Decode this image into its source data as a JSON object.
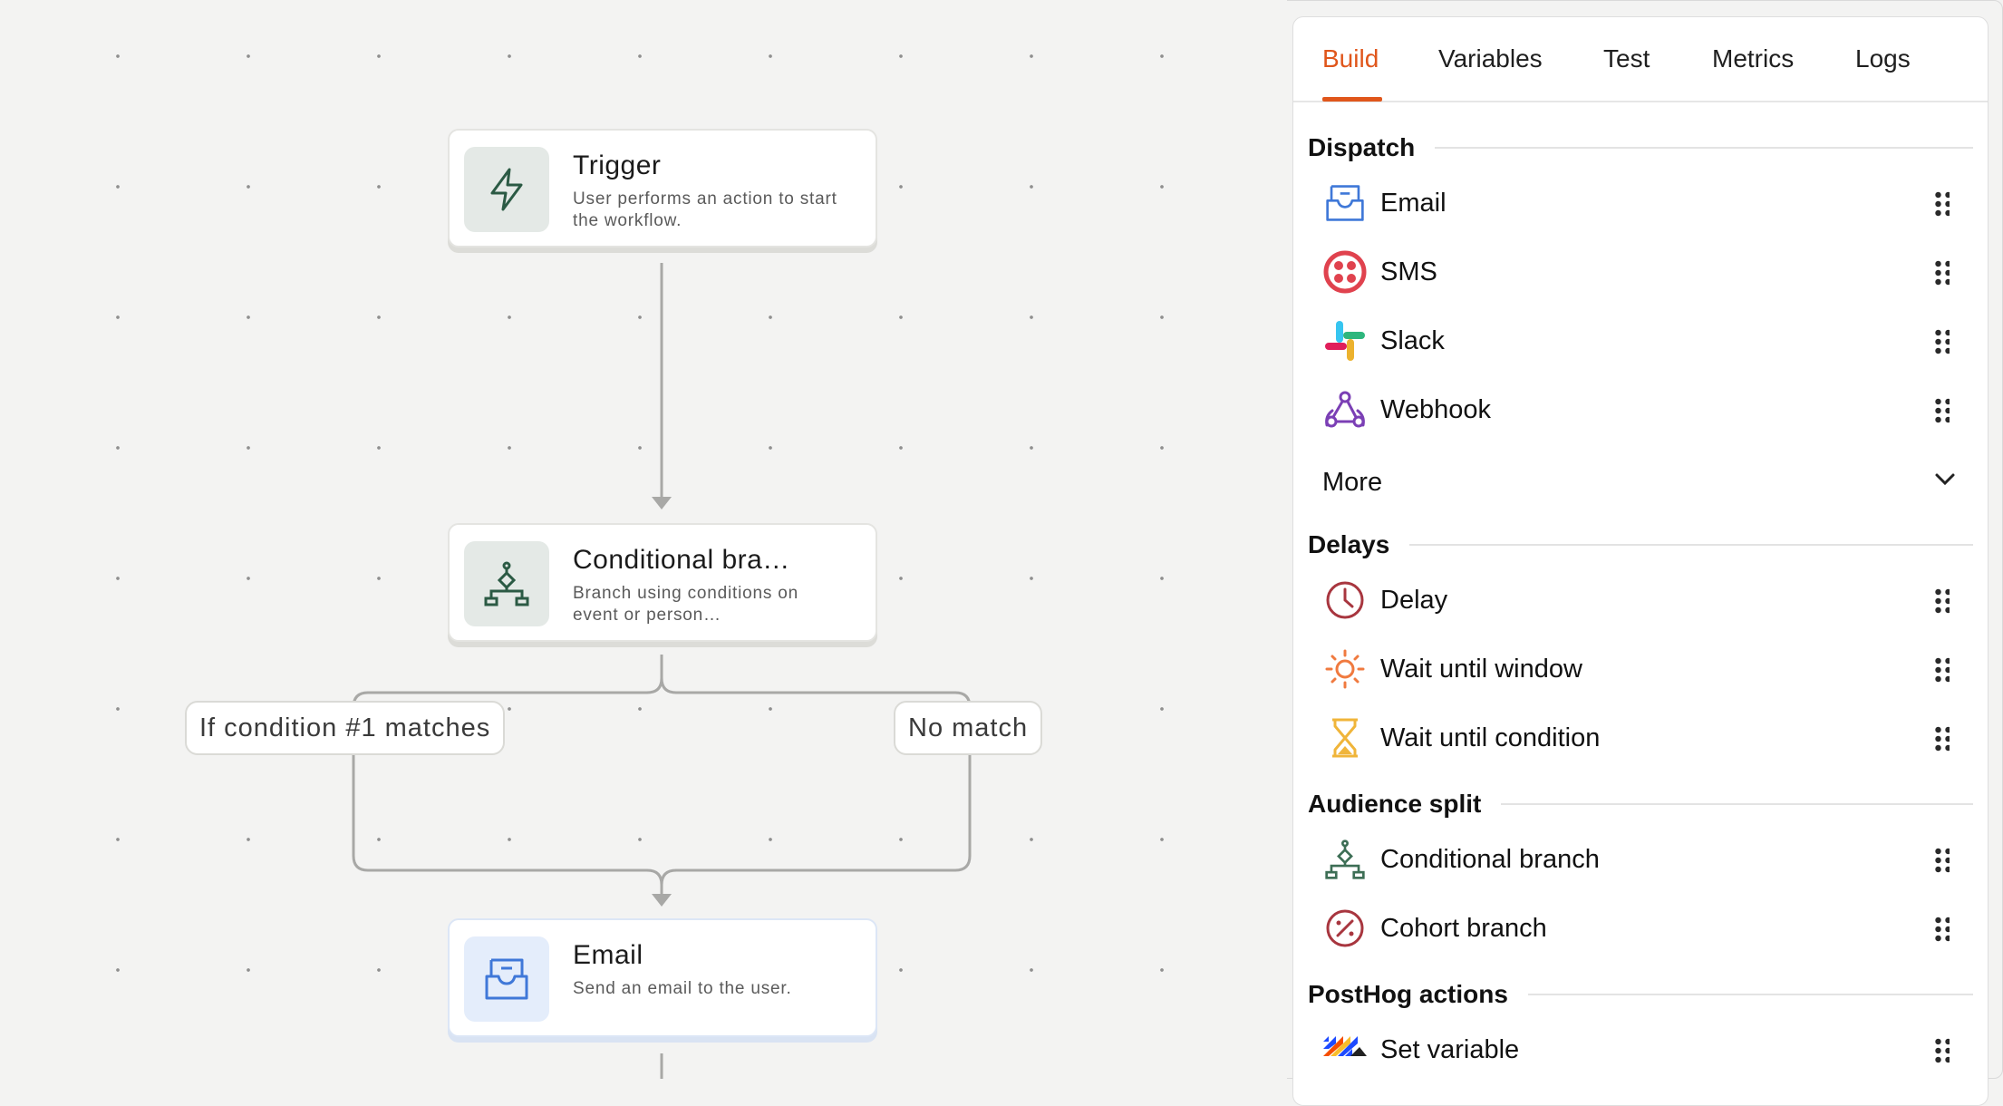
{
  "canvas": {
    "nodes": [
      {
        "id": "trigger",
        "title": "Trigger",
        "desc": "User performs an action to start the workflow.",
        "icon": "lightning-icon"
      },
      {
        "id": "conditional",
        "title": "Conditional bra…",
        "desc": "Branch using conditions on event or person…",
        "icon": "branch-icon"
      },
      {
        "id": "email",
        "title": "Email",
        "desc": "Send an email to the user.",
        "icon": "email-icon"
      }
    ],
    "branch_labels": [
      "If condition #1 matches",
      "No match"
    ]
  },
  "panel": {
    "tabs": [
      "Build",
      "Variables",
      "Test",
      "Metrics",
      "Logs"
    ],
    "active_tab": "Build",
    "sections": [
      {
        "title": "Dispatch",
        "items": [
          {
            "label": "Email",
            "icon": "email-icon"
          },
          {
            "label": "SMS",
            "icon": "twilio-icon"
          },
          {
            "label": "Slack",
            "icon": "slack-icon"
          },
          {
            "label": "Webhook",
            "icon": "webhook-icon"
          }
        ],
        "more_label": "More"
      },
      {
        "title": "Delays",
        "items": [
          {
            "label": "Delay",
            "icon": "clock-icon"
          },
          {
            "label": "Wait until window",
            "icon": "sun-icon"
          },
          {
            "label": "Wait until condition",
            "icon": "hourglass-icon"
          }
        ]
      },
      {
        "title": "Audience split",
        "items": [
          {
            "label": "Conditional branch",
            "icon": "branch-icon"
          },
          {
            "label": "Cohort branch",
            "icon": "percent-icon"
          }
        ]
      },
      {
        "title": "PostHog actions",
        "items": [
          {
            "label": "Set variable",
            "icon": "posthog-icon"
          }
        ]
      }
    ]
  },
  "colors": {
    "accent": "#e0561b",
    "canvas_bg": "#f3f3f2",
    "node_icon_green": "#2b5a44",
    "email_blue": "#3f78d8"
  }
}
